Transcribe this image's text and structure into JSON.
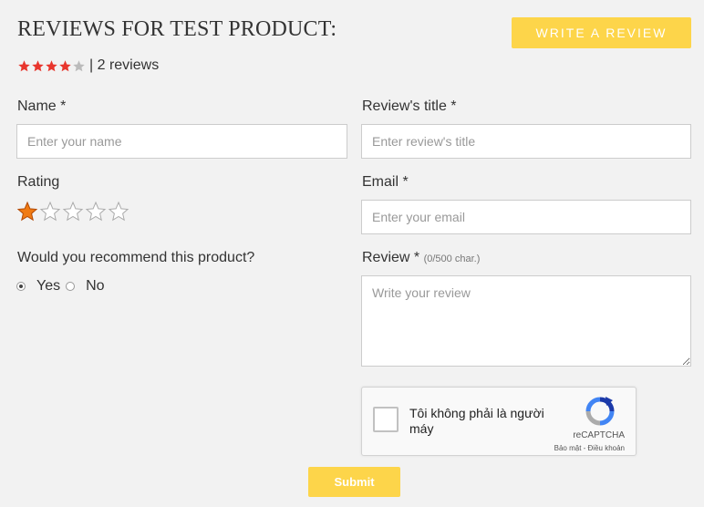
{
  "header": {
    "title": "REVIEWS FOR TEST PRODUCT:",
    "write_review_label": "WRITE A REVIEW"
  },
  "summary": {
    "average_rating": 4,
    "max_rating": 5,
    "separator": "|",
    "reviews_text": "2 reviews"
  },
  "form": {
    "name": {
      "label": "Name *",
      "placeholder": "Enter your name",
      "value": ""
    },
    "title": {
      "label": "Review's title *",
      "placeholder": "Enter review's title",
      "value": ""
    },
    "rating": {
      "label": "Rating",
      "value": 1,
      "max": 5
    },
    "email": {
      "label": "Email *",
      "placeholder": "Enter your email",
      "value": ""
    },
    "recommend": {
      "question": "Would you recommend this product?",
      "options": [
        "Yes",
        "No"
      ],
      "selected": "Yes"
    },
    "review": {
      "label": "Review *",
      "char_hint": "(0/500 char.)",
      "placeholder": "Write your review",
      "value": ""
    },
    "submit_label": "Submit"
  },
  "captcha": {
    "text": "Tôi không phải là người máy",
    "brand": "reCAPTCHA",
    "links": "Bảo mật - Điều khoản"
  },
  "colors": {
    "accent": "#fdd54a",
    "star_filled": "#e8362d",
    "star_empty": "#bbbbbb",
    "background": "#f2f2f2"
  }
}
